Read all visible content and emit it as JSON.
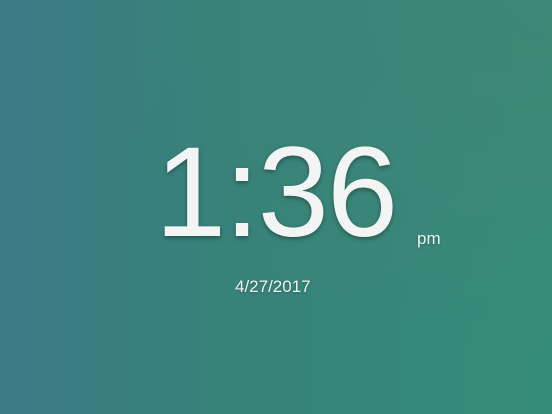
{
  "clock": {
    "time": "1:36",
    "meridiem": "pm",
    "date": "4/27/2017"
  },
  "colors": {
    "background_left": "#3c7a86",
    "background_right": "#358c78",
    "text": "#f3f5f4"
  }
}
